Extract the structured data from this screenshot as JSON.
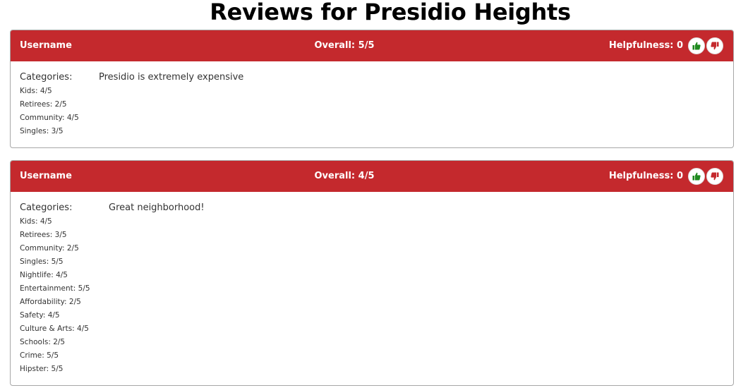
{
  "page": {
    "title": "Reviews for Presidio Heights"
  },
  "colors": {
    "header_background": "#c4292d",
    "thumbs_up": "#1e8a1e",
    "thumbs_down": "#c4292d"
  },
  "reviews": [
    {
      "username": "Username",
      "overall": "Overall: 5/5",
      "helpfulness": "Helpfulness: 0",
      "categories_label": "Categories:",
      "categories": [
        "Kids: 4/5",
        "Retirees: 2/5",
        "Community: 4/5",
        "Singles: 3/5"
      ],
      "text": "Presidio is extremely expensive"
    },
    {
      "username": "Username",
      "overall": "Overall: 4/5",
      "helpfulness": "Helpfulness: 0",
      "categories_label": "Categories:",
      "categories": [
        "Kids: 4/5",
        "Retirees: 3/5",
        "Community: 2/5",
        "Singles: 5/5",
        "Nightlife: 4/5",
        "Entertainment: 5/5",
        "Affordability: 2/5",
        "Safety: 4/5",
        "Culture & Arts: 4/5",
        "Schools: 2/5",
        "Crime: 5/5",
        "Hipster: 5/5"
      ],
      "text": "Great neighborhood!"
    }
  ],
  "icons": {
    "upvote": "thumbs-up-icon",
    "downvote": "thumbs-down-icon"
  }
}
